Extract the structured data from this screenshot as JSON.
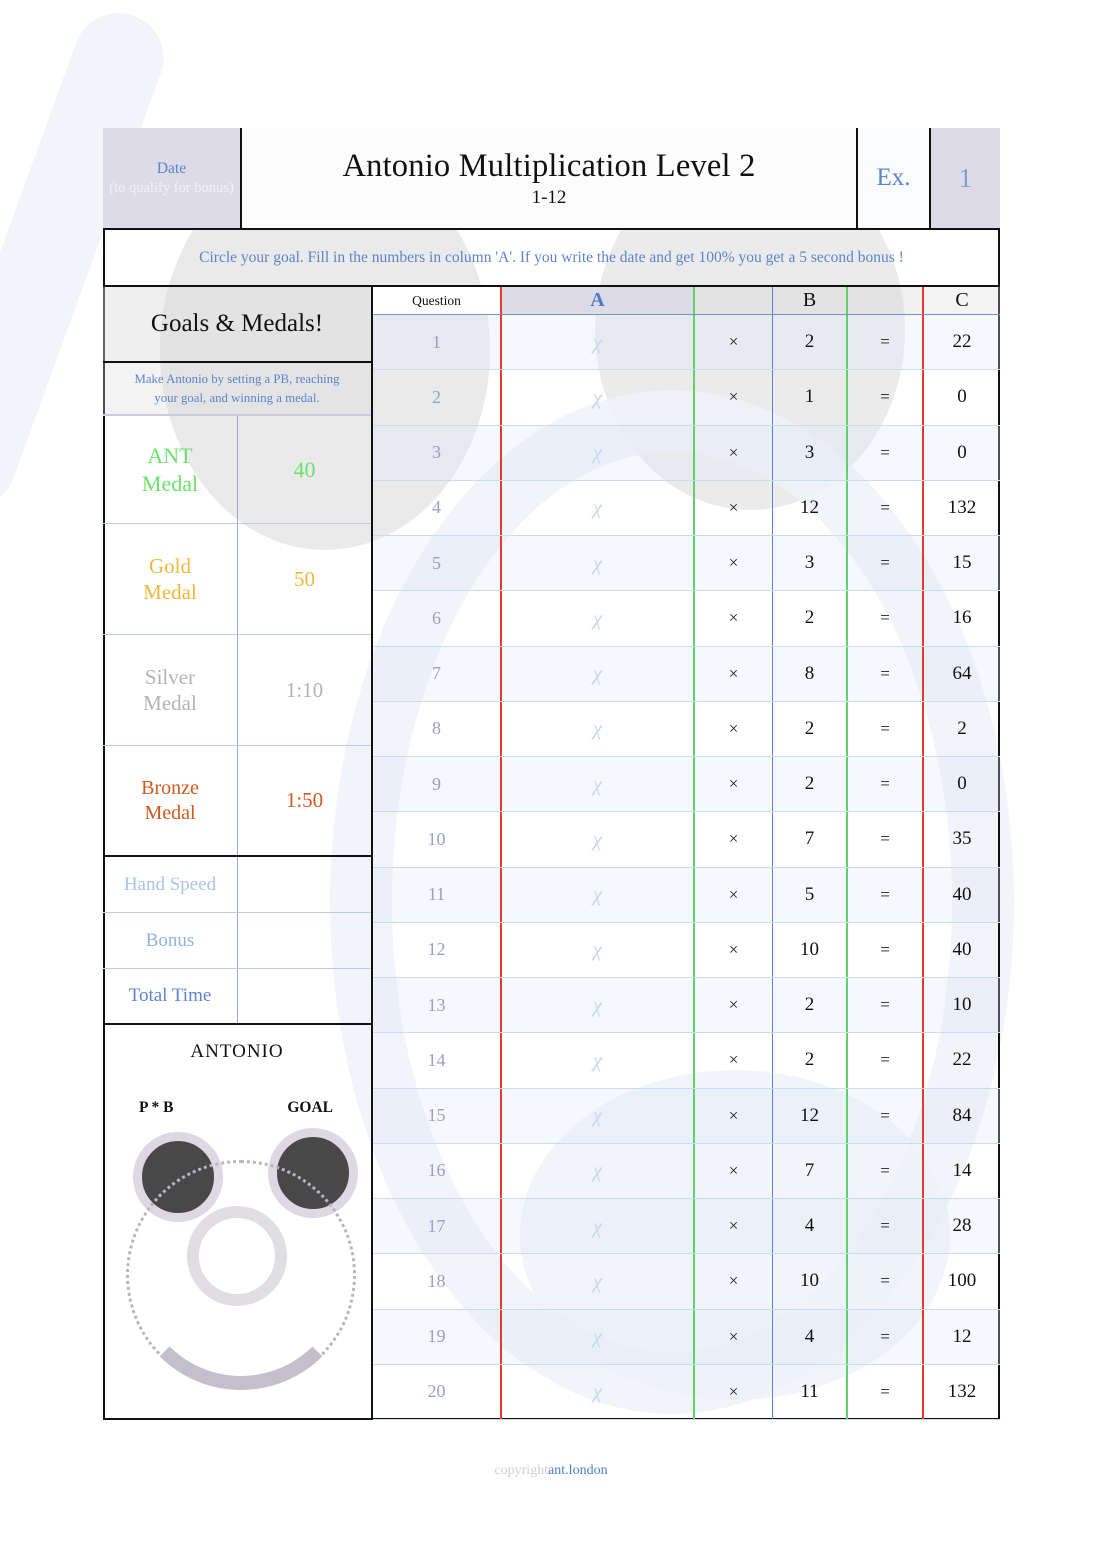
{
  "header": {
    "date_label": "Date",
    "date_sub": "(to qualify for bonus)",
    "title": "Antonio Multiplication Level 2",
    "subtitle": "1-12",
    "ex_label": "Ex.",
    "ex_number": "1"
  },
  "banner": {
    "text": "Circle your goal. Fill in the numbers in column 'A'. If you write the date and get 100% you get a 5 second bonus !"
  },
  "goals": {
    "title": "Goals & Medals!",
    "subtitle_line1": "Make Antonio by setting a PB, reaching",
    "subtitle_line2": "your goal, and winning a medal.",
    "medals": [
      {
        "name_line1": "ANT",
        "name_line2": "Medal",
        "value": "40",
        "color": "#6ce26c"
      },
      {
        "name_line1": "Gold",
        "name_line2": "Medal",
        "value": "50",
        "color": "#efb83c"
      },
      {
        "name_line1": "Silver",
        "name_line2": "Medal",
        "value": "1:10",
        "color": "#b3b3b3"
      },
      {
        "name_line1": "Bronze",
        "name_line2": "Medal",
        "value": "1:50",
        "color": "#d1591f"
      }
    ],
    "stats": [
      {
        "label": "Hand Speed",
        "value": ""
      },
      {
        "label": "Bonus",
        "value": ""
      },
      {
        "label": "Total Time",
        "value": ""
      }
    ]
  },
  "antonio": {
    "name": "ANTONIO",
    "pb_label": "P * B",
    "goal_label": "GOAL"
  },
  "table": {
    "headers": {
      "question": "Question",
      "a": "A",
      "op": "",
      "b": "B",
      "eq": "",
      "c": "C"
    },
    "placeholder_a": "χ",
    "operator": "×",
    "equals": "=",
    "rows": [
      {
        "q": "1",
        "a": "",
        "b": "2",
        "c": "22"
      },
      {
        "q": "2",
        "a": "",
        "b": "1",
        "c": "0"
      },
      {
        "q": "3",
        "a": "",
        "b": "3",
        "c": "0"
      },
      {
        "q": "4",
        "a": "",
        "b": "12",
        "c": "132"
      },
      {
        "q": "5",
        "a": "",
        "b": "3",
        "c": "15"
      },
      {
        "q": "6",
        "a": "",
        "b": "2",
        "c": "16"
      },
      {
        "q": "7",
        "a": "",
        "b": "8",
        "c": "64"
      },
      {
        "q": "8",
        "a": "",
        "b": "2",
        "c": "2"
      },
      {
        "q": "9",
        "a": "",
        "b": "2",
        "c": "0"
      },
      {
        "q": "10",
        "a": "",
        "b": "7",
        "c": "35"
      },
      {
        "q": "11",
        "a": "",
        "b": "5",
        "c": "40"
      },
      {
        "q": "12",
        "a": "",
        "b": "10",
        "c": "40"
      },
      {
        "q": "13",
        "a": "",
        "b": "2",
        "c": "10"
      },
      {
        "q": "14",
        "a": "",
        "b": "2",
        "c": "22"
      },
      {
        "q": "15",
        "a": "",
        "b": "12",
        "c": "84"
      },
      {
        "q": "16",
        "a": "",
        "b": "7",
        "c": "14"
      },
      {
        "q": "17",
        "a": "",
        "b": "4",
        "c": "28"
      },
      {
        "q": "18",
        "a": "",
        "b": "10",
        "c": "100"
      },
      {
        "q": "19",
        "a": "",
        "b": "4",
        "c": "12"
      },
      {
        "q": "20",
        "a": "",
        "b": "11",
        "c": "132"
      }
    ]
  },
  "footer": {
    "copyright": "copyright",
    "site": "ant.london"
  },
  "colors": {
    "accent_blue": "#5b85cc",
    "header_lilac": "#dedbe8",
    "rule_red": "#e8392e",
    "rule_green": "#5fd36a",
    "rule_blue": "#5b85cc"
  }
}
